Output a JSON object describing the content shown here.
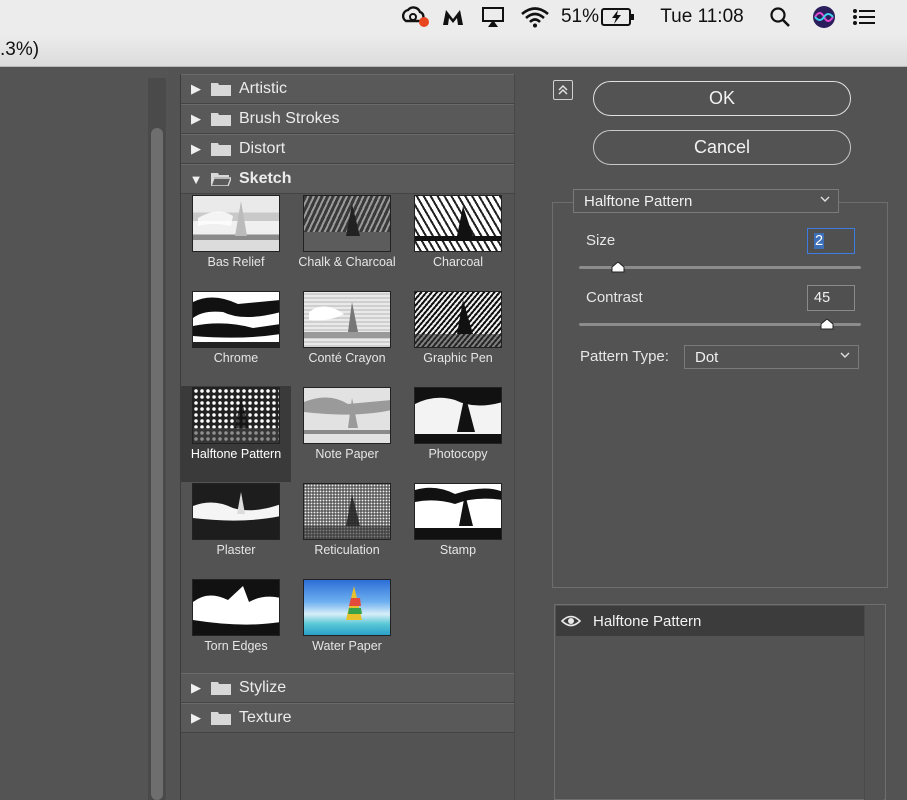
{
  "menubar": {
    "battery": "51%",
    "clock": "Tue 11:08",
    "icons": [
      "creative-cloud-icon",
      "malwarebytes-icon",
      "airplay-icon",
      "wifi-icon",
      "battery-charging-icon",
      "spotlight-search-icon",
      "siri-icon",
      "notification-center-icon"
    ]
  },
  "window": {
    "title_fragment": ".3%)"
  },
  "gallery": {
    "categories_top": [
      {
        "label": "Artistic",
        "expanded": false
      },
      {
        "label": "Brush Strokes",
        "expanded": false
      },
      {
        "label": "Distort",
        "expanded": false
      },
      {
        "label": "Sketch",
        "expanded": true
      }
    ],
    "sketch_filters": [
      "Bas Relief",
      "Chalk & Charcoal",
      "Charcoal",
      "Chrome",
      "Conté Crayon",
      "Graphic Pen",
      "Halftone Pattern",
      "Note Paper",
      "Photocopy",
      "Plaster",
      "Reticulation",
      "Stamp",
      "Torn Edges",
      "Water Paper"
    ],
    "selected_filter": "Halftone Pattern",
    "categories_bottom": [
      {
        "label": "Stylize",
        "expanded": false
      },
      {
        "label": "Texture",
        "expanded": false
      }
    ]
  },
  "buttons": {
    "ok": "OK",
    "cancel": "Cancel"
  },
  "settings": {
    "filter_name": "Halftone Pattern",
    "size_label": "Size",
    "size_value": "2",
    "size_slider_fraction": 0.14,
    "contrast_label": "Contrast",
    "contrast_value": "45",
    "contrast_slider_fraction": 0.88,
    "pattern_type_label": "Pattern Type:",
    "pattern_type_value": "Dot"
  },
  "layers": [
    {
      "name": "Halftone Pattern",
      "visible": true
    }
  ],
  "colors": {
    "dialog_bg": "#535353",
    "selection_blue": "#3d7be0",
    "menubar_bg": "#ececec"
  }
}
